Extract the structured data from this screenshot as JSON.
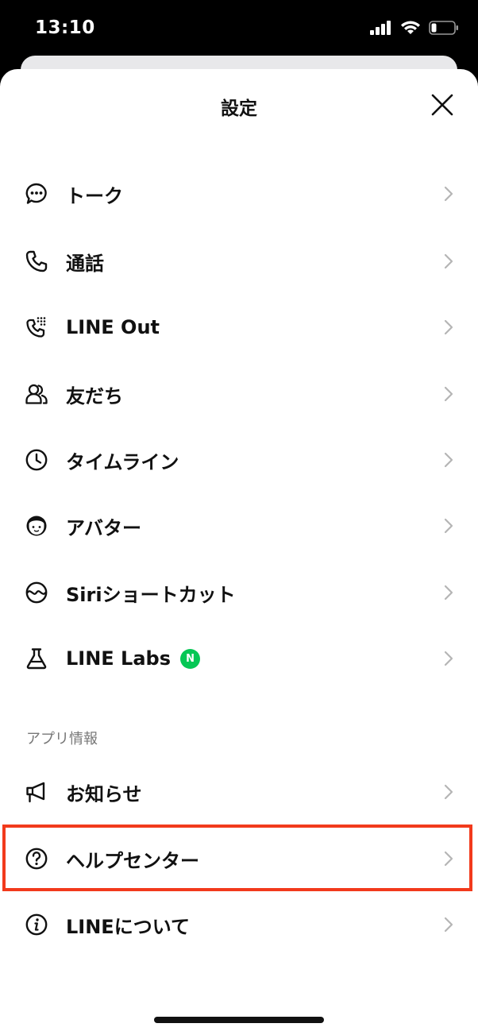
{
  "status_bar": {
    "time": "13:10"
  },
  "header": {
    "title": "設定"
  },
  "menu": {
    "items": [
      {
        "label": "トーク",
        "icon": "chat-bubble-icon"
      },
      {
        "label": "通話",
        "icon": "phone-icon"
      },
      {
        "label": "LINE Out",
        "icon": "phone-keypad-icon"
      },
      {
        "label": "友だち",
        "icon": "friends-icon"
      },
      {
        "label": "タイムライン",
        "icon": "clock-icon"
      },
      {
        "label": "アバター",
        "icon": "avatar-face-icon"
      },
      {
        "label": "Siriショートカット",
        "icon": "siri-icon"
      },
      {
        "label": "LINE Labs",
        "icon": "flask-icon",
        "badge": "N"
      }
    ]
  },
  "app_info": {
    "section_label": "アプリ情報",
    "items": [
      {
        "label": "お知らせ",
        "icon": "megaphone-icon"
      },
      {
        "label": "ヘルプセンター",
        "icon": "question-circle-icon"
      },
      {
        "label": "LINEについて",
        "icon": "info-circle-icon"
      }
    ]
  },
  "colors": {
    "badge_green": "#06c755",
    "highlight_red": "#f23a1c"
  }
}
